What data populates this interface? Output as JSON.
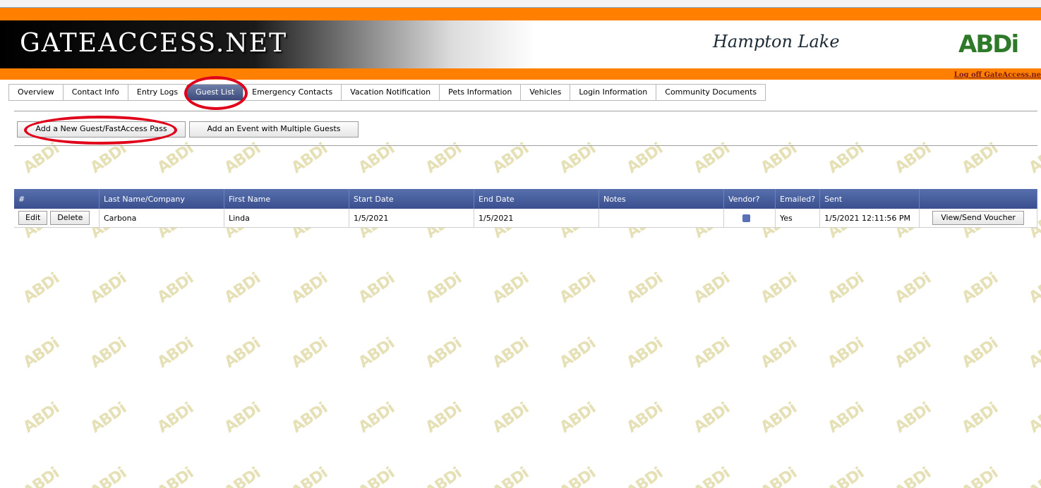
{
  "header": {
    "site_title": "GATEACCESS.NET",
    "community_name": "Hampton Lake",
    "company_logo": "ABDi",
    "logoff_label": "Log off GateAccess.ne"
  },
  "tabs": [
    {
      "label": "Overview",
      "active": false
    },
    {
      "label": "Contact Info",
      "active": false
    },
    {
      "label": "Entry Logs",
      "active": false
    },
    {
      "label": "Guest List",
      "active": true
    },
    {
      "label": "Emergency Contacts",
      "active": false
    },
    {
      "label": "Vacation Notification",
      "active": false
    },
    {
      "label": "Pets Information",
      "active": false
    },
    {
      "label": "Vehicles",
      "active": false
    },
    {
      "label": "Login Information",
      "active": false
    },
    {
      "label": "Community Documents",
      "active": false
    }
  ],
  "actions": {
    "add_guest_label": "Add a New Guest/FastAccess Pass",
    "add_event_label": "Add an Event with Multiple Guests"
  },
  "table": {
    "headers": [
      "#",
      "Last Name/Company",
      "First Name",
      "Start Date",
      "End Date",
      "Notes",
      "Vendor?",
      "Emailed?",
      "Sent",
      ""
    ],
    "rows": [
      {
        "edit_label": "Edit",
        "delete_label": "Delete",
        "last_name": "Carbona",
        "first_name": "Linda",
        "start_date": "1/5/2021",
        "end_date": "1/5/2021",
        "notes": "",
        "vendor": false,
        "emailed": "Yes",
        "sent": "1/5/2021 12:11:56 PM",
        "voucher_label": "View/Send Voucher"
      }
    ]
  },
  "colors": {
    "orange": "#ff8000",
    "header_blue": "#3a4f8e",
    "highlight_red": "#e0001a",
    "watermark": "#e6e0b6"
  },
  "watermark_text": "ABDi"
}
